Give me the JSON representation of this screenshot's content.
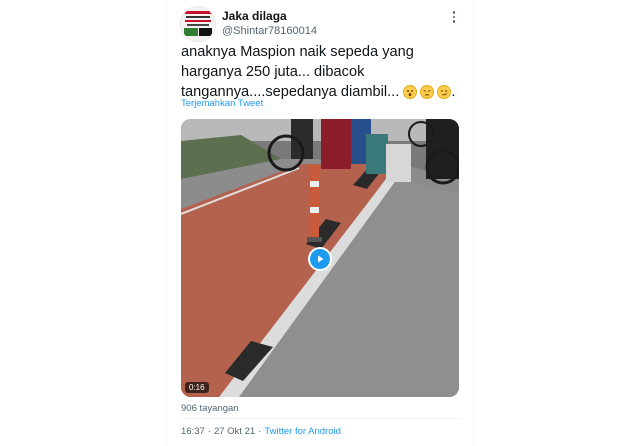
{
  "tweet": {
    "author_name": "Jaka dilaga",
    "author_handle": "@Shintar78160014",
    "text_main": "anaknya Maspion naik sepeda  yang harganya 250 juta... dibacok tangannya....sepedanya diambil...",
    "text_tail": ".",
    "emoji_icons": [
      "astonished-face-icon",
      "weary-face-icon",
      "smirking-face-icon"
    ],
    "translate_link": "Terjemahkan Tweet",
    "video": {
      "duration": "0:16"
    },
    "views": "906 tayangan",
    "time": "16:37",
    "separator": "·",
    "date": "27 Okt 21",
    "source": "Twitter for Android"
  },
  "colors": {
    "link": "#1d9bf0",
    "secondary_text": "#536471",
    "primary_text": "#0f1419",
    "play_button": "#1d9bf0"
  }
}
